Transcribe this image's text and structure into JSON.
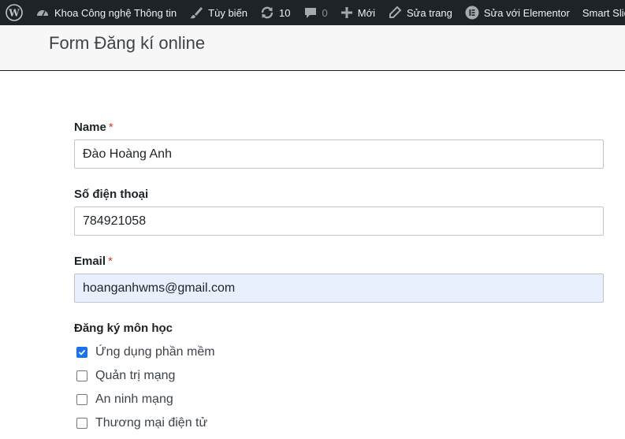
{
  "adminbar": {
    "site_name": "Khoa Công nghệ Thông tin",
    "customize": "Tùy biến",
    "updates_count": "10",
    "comments_count": "0",
    "new": "Mới",
    "edit_page": "Sửa trang",
    "edit_elementor": "Sửa với Elementor",
    "smart_slider": "Smart Slid"
  },
  "page": {
    "title": "Form Đăng kí online"
  },
  "form": {
    "name_label": "Name",
    "name_required": "*",
    "name_value": "Đào Hoàng Anh",
    "phone_label": "Số điện thoại",
    "phone_value": "784921058",
    "email_label": "Email",
    "email_required": "*",
    "email_value": "hoanganhwms@gmail.com",
    "courses_label": "Đăng ký môn học",
    "courses": [
      {
        "label": "Ứng dụng phần mềm",
        "checked": true
      },
      {
        "label": "Quản trị mạng",
        "checked": false
      },
      {
        "label": "An ninh mạng",
        "checked": false
      },
      {
        "label": "Thương mại điện tử",
        "checked": false
      }
    ]
  },
  "colors": {
    "adminbar_bg": "#1d2327",
    "checkbox_accent": "#1a73e8",
    "autofill_bg": "#e8f0fe",
    "required": "#d63638"
  }
}
